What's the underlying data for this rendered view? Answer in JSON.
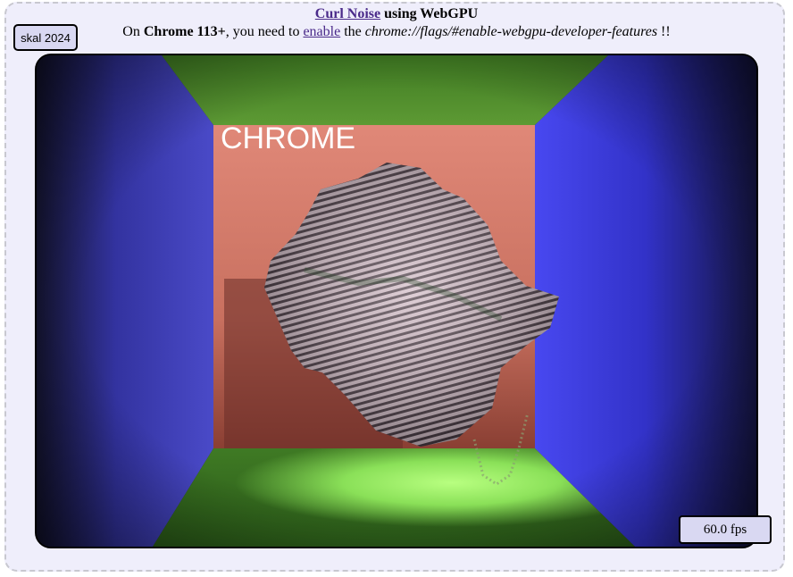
{
  "header": {
    "title_link": "Curl Noise",
    "title_rest": " using WebGPU",
    "sub_prefix": "On ",
    "sub_browser": "Chrome 113+",
    "sub_mid": ", you need to ",
    "sub_link": "enable",
    "sub_the": " the ",
    "sub_flag": "chrome://flags/#enable-webgpu-developer-features",
    "sub_suffix": " !!"
  },
  "badge": {
    "label": "skal 2024"
  },
  "canvas": {
    "overlay_text": "CHROME"
  },
  "status": {
    "fps": "60.0 fps"
  },
  "colors": {
    "frame_bg": "#efeefb",
    "link": "#4a2a8a",
    "badge_bg": "#d9d8f2",
    "wall_left": "#3a3aa8",
    "wall_right": "#3a3ad8",
    "wall_back": "#d97f72",
    "ceiling": "#4f8a2a",
    "floor": "#6ac83a"
  }
}
